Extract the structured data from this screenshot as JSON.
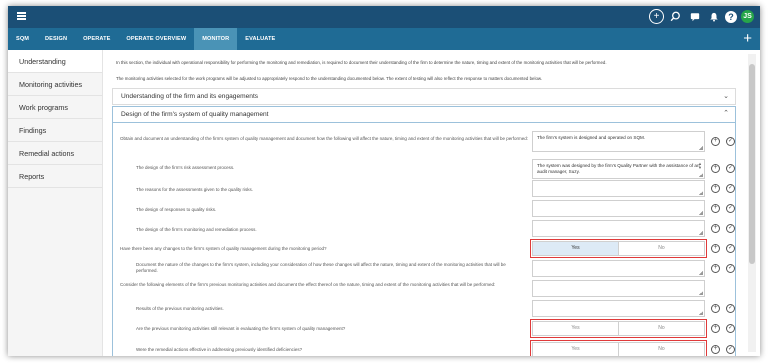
{
  "nav": {
    "tabs": [
      {
        "label": "SQM"
      },
      {
        "label": "DESIGN"
      },
      {
        "label": "OPERATE"
      },
      {
        "label": "OPERATE OVERVIEW"
      },
      {
        "label": "MONITOR"
      },
      {
        "label": "EVALUATE"
      }
    ],
    "active_tab": "MONITOR"
  },
  "user": {
    "initials": "JS"
  },
  "sidebar": {
    "items": [
      {
        "label": "Understanding"
      },
      {
        "label": "Monitoring activities"
      },
      {
        "label": "Work programs"
      },
      {
        "label": "Findings"
      },
      {
        "label": "Remedial actions"
      },
      {
        "label": "Reports"
      }
    ]
  },
  "intro": {
    "line1": "In this section, the individual with operational responsibility for performing the monitoring and remediation, is required to document their understanding of the firm to determine the nature, timing and extent of the monitoring activities that will be performed.",
    "line2": "The monitoring activities selected for the work programs will be adjusted to appropriately respond to the understanding documented below. The extent of testing will also reflect the response to matters documented below."
  },
  "sections": {
    "collapsed_title": "Understanding of the firm and its engagements",
    "expanded_title": "Design of the firm's system of quality management"
  },
  "questions": [
    {
      "text": "Obtain and document an understanding of the firm's system of quality management and document how the following will affect the nature, timing and extent of the monitoring activities that will be performed:",
      "answer": "The firm's system is designed and operated on SQM."
    },
    {
      "text": "The design of the firm's risk assessment process.",
      "answer": "The system was designed by the firm's Quality Partner with the assistance of an audit manager, Suzy."
    },
    {
      "text": "The reasons for the assessments given to the quality risks.",
      "answer": ""
    },
    {
      "text": "The design of responses to quality risks.",
      "answer": ""
    },
    {
      "text": "The design of the firm's monitoring and remediation process.",
      "answer": ""
    },
    {
      "text": "Have there been any changes to the firm's system of quality management during the monitoring period?",
      "answer": ""
    },
    {
      "text": "Document the nature of the changes to the firm's system, including your consideration of how these changes will affect the nature, timing and extent of the monitoring activities that will be performed.",
      "answer": ""
    },
    {
      "text": "Consider the following elements of the firm's previous monitoring activities and document the effect thereof on the nature, timing and extent of the monitoring activities that will be performed:",
      "answer": ""
    },
    {
      "text": "Results of the previous monitoring activities.",
      "answer": ""
    },
    {
      "text": "Are the previous monitoring activities still relevant in evaluating the firm's system of quality management?",
      "answer": ""
    },
    {
      "text": "Were the remedial actions effective in addressing previously identified deficiencies?",
      "answer": ""
    }
  ],
  "yesno": {
    "yes_label": "Yes",
    "no_label": "No"
  },
  "colors": {
    "topbar": "#1b4f76",
    "navbar": "#1f6b95",
    "active_tab": "#4a93b6",
    "highlight_border": "#e03a3a",
    "selected_yes": "#ddeaf6"
  },
  "icons": [
    "hamburger-menu-icon",
    "add-circle-icon",
    "search-icon",
    "chat-icon",
    "notification-icon",
    "help-icon",
    "plus-icon",
    "chevron-down-icon",
    "chevron-up-icon",
    "add-comment-icon",
    "check-circle-icon"
  ]
}
